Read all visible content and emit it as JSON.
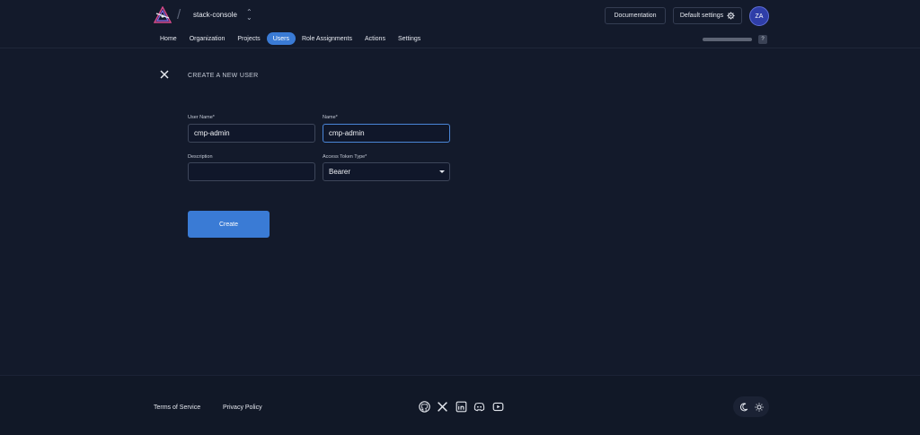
{
  "header": {
    "project_name": "stack-console",
    "documentation_label": "Documentation",
    "default_settings_label": "Default settings",
    "avatar_initials": "ZA",
    "help_label": "?"
  },
  "nav": {
    "items": [
      {
        "label": "Home",
        "active": false
      },
      {
        "label": "Organization",
        "active": false
      },
      {
        "label": "Projects",
        "active": false
      },
      {
        "label": "Users",
        "active": true
      },
      {
        "label": "Role Assignments",
        "active": false
      },
      {
        "label": "Actions",
        "active": false
      },
      {
        "label": "Settings",
        "active": false
      }
    ]
  },
  "page": {
    "title": "CREATE A NEW USER"
  },
  "form": {
    "username_label": "User Name*",
    "username_value": "cmp-admin",
    "name_label": "Name*",
    "name_value": "cmp-admin",
    "description_label": "Description",
    "description_value": "",
    "token_type_label": "Access Token Type*",
    "token_type_value": "Bearer",
    "create_label": "Create"
  },
  "footer": {
    "terms_label": "Terms of Service",
    "privacy_label": "Privacy Policy",
    "social_icons": [
      "github-icon",
      "x-icon",
      "linkedin-icon",
      "discord-icon",
      "youtube-icon"
    ]
  },
  "colors": {
    "background": "#131a2b",
    "accent": "#3a7bd5",
    "avatar": "#2f3ea8"
  }
}
